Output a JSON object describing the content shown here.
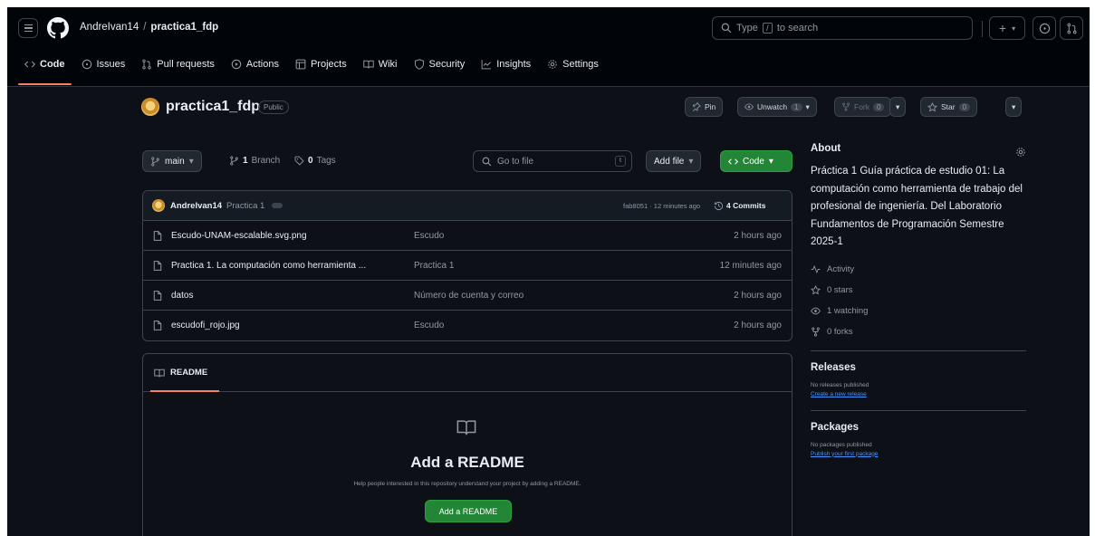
{
  "header": {
    "owner": "AndreIvan14",
    "separator": "/",
    "repo": "practica1_fdp",
    "search_placeholder_pre": "Type",
    "search_key": "/",
    "search_placeholder_post": "to search",
    "plus_label": "+"
  },
  "nav": {
    "tabs": [
      {
        "label": "Code"
      },
      {
        "label": "Issues"
      },
      {
        "label": "Pull requests"
      },
      {
        "label": "Actions"
      },
      {
        "label": "Projects"
      },
      {
        "label": "Wiki"
      },
      {
        "label": "Security"
      },
      {
        "label": "Insights"
      },
      {
        "label": "Settings"
      }
    ]
  },
  "repo_header": {
    "title": "practica1_fdp",
    "visibility": "Public",
    "pin": "Pin",
    "unwatch": "Unwatch",
    "unwatch_count": "1",
    "fork": "Fork",
    "fork_count": "0",
    "star": "Star",
    "star_count": "0"
  },
  "toolbar": {
    "branch": "main",
    "branch_count": "1",
    "branch_word": "Branch",
    "tag_count": "0",
    "tag_word": "Tags",
    "goto_placeholder": "Go to file",
    "goto_key": "t",
    "add_file": "Add file",
    "code": "Code"
  },
  "latest_commit": {
    "author": "AndreIvan14",
    "message": "Practica 1",
    "sha_time": "fab8051 · 12 minutes ago",
    "commits": "4 Commits"
  },
  "files": [
    {
      "name": "Escudo-UNAM-escalable.svg.png",
      "message": "Escudo",
      "date": "2 hours ago"
    },
    {
      "name": "Practica 1. La computación como herramienta ...",
      "message": "Practica 1",
      "date": "12 minutes ago"
    },
    {
      "name": "datos",
      "message": "Número de cuenta y correo",
      "date": "2 hours ago"
    },
    {
      "name": "escudofi_rojo.jpg",
      "message": "Escudo",
      "date": "2 hours ago"
    }
  ],
  "readme": {
    "tab": "README",
    "title": "Add a README",
    "description": "Help people interested in this repository understand your project by adding a README.",
    "button": "Add a README"
  },
  "about": {
    "heading": "About",
    "description": "Práctica 1 Guía práctica de estudio 01: La computación como herramienta de trabajo del profesional de ingeniería. Del Laboratorio Fundamentos de Programación Semestre 2025-1",
    "activity": "Activity",
    "stars": "0 stars",
    "watching": "1 watching",
    "forks": "0 forks"
  },
  "releases": {
    "heading": "Releases",
    "none": "No releases published",
    "link": "Create a new release"
  },
  "packages": {
    "heading": "Packages",
    "none": "No packages published",
    "link": "Publish your first package"
  },
  "colors": {
    "background": "#0d1117",
    "header": "#010409",
    "border": "#3d444d",
    "accent_tab": "#f78166",
    "green_button": "#238636",
    "link": "#4493f8"
  }
}
